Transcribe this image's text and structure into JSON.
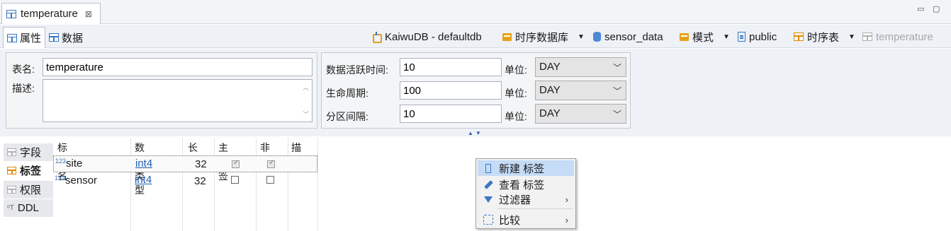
{
  "editor_tab": {
    "title": "temperature",
    "close": "⊠"
  },
  "window_controls": {
    "minimize": "▭",
    "maximize": "▢"
  },
  "inner_tabs": [
    {
      "label": "属性",
      "active": true
    },
    {
      "label": "数据",
      "active": false
    }
  ],
  "breadcrumb": {
    "connection": "KaiwuDB - defaultdb",
    "database_type": "时序数据库",
    "database": "sensor_data",
    "schema_folder": "模式",
    "schema": "public",
    "table_type": "时序表",
    "table": "temperature",
    "dropdown_caret": "▼"
  },
  "properties": {
    "table_name_label": "表名:",
    "table_name": "temperature",
    "description_label": "描述:",
    "description": "",
    "active_time_label": "数据活跃时间:",
    "active_time": "10",
    "lifetime_label": "生命周期:",
    "lifetime": "100",
    "partition_label": "分区间隔:",
    "partition": "10",
    "unit_label": "单位:",
    "unit_active": "DAY",
    "unit_lifetime": "DAY",
    "unit_partition": "DAY",
    "unit_options": [
      "DAY"
    ]
  },
  "side_tabs": [
    {
      "label": "字段",
      "icon": "columns-icon",
      "active": false
    },
    {
      "label": "标签",
      "icon": "tags-icon",
      "active": true
    },
    {
      "label": "权限",
      "icon": "key-icon",
      "active": false
    },
    {
      "label": "DDL",
      "icon": "ddl-icon",
      "active": false
    }
  ],
  "grid": {
    "headers": [
      "标签名",
      "数据类型",
      "长度",
      "主标签",
      "非空",
      "描述"
    ],
    "type_prefix": "123",
    "rows": [
      {
        "name": "site",
        "type": "int4",
        "length": "32",
        "primary": true,
        "not_null": true,
        "desc": ""
      },
      {
        "name": "sensor",
        "type": "int4",
        "length": "32",
        "primary": false,
        "not_null": false,
        "desc": ""
      }
    ]
  },
  "context_menu": {
    "items": [
      {
        "label": "新建 标签",
        "icon": "new-tag-icon",
        "highlighted": true
      },
      {
        "label": "查看 标签",
        "icon": "pencil-icon",
        "highlighted": false
      },
      {
        "label": "过滤器",
        "icon": "filter-icon",
        "submenu": true
      },
      {
        "label": "比较",
        "icon": "compare-icon",
        "submenu": true
      }
    ],
    "submenu_arrow": "›"
  },
  "colors": {
    "accent": "#3b76c4",
    "folder": "#e6a117",
    "menu_highlight": "#c5dcf7"
  }
}
